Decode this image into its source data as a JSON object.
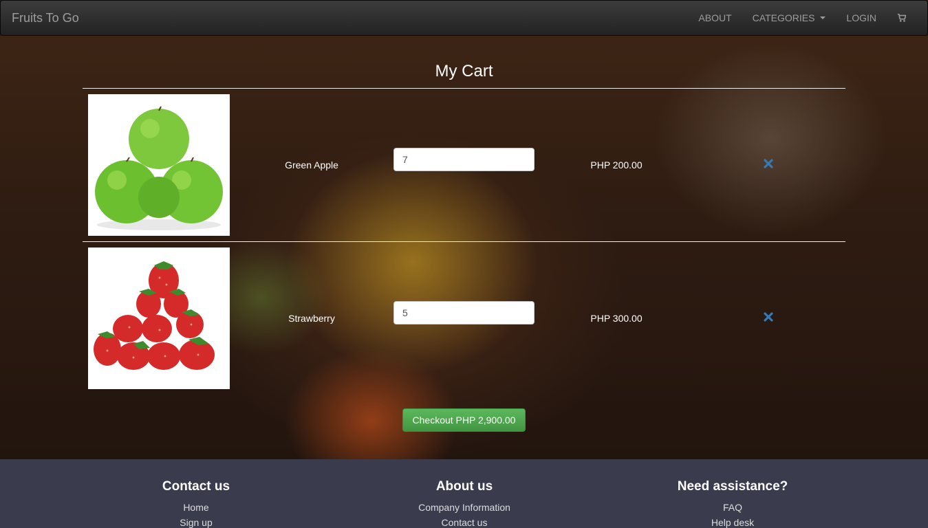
{
  "navbar": {
    "brand": "Fruits To Go",
    "links": [
      "ABOUT",
      "CATEGORIES",
      "LOGIN"
    ],
    "cart_icon": "shopping-cart-icon"
  },
  "cart": {
    "title": "My Cart",
    "items": [
      {
        "name": "Green Apple",
        "quantity": "7",
        "price": "PHP 200.00",
        "image": "green-apple-image"
      },
      {
        "name": "Strawberry",
        "quantity": "5",
        "price": "PHP 300.00",
        "image": "strawberry-image"
      }
    ],
    "remove_icon": "remove-x-icon",
    "checkout_label": "Checkout PHP 2,900.00"
  },
  "footer": {
    "columns": [
      {
        "title": "Contact us",
        "links": [
          "Home",
          "Sign up"
        ]
      },
      {
        "title": "About us",
        "links": [
          "Company Information",
          "Contact us"
        ]
      },
      {
        "title": "Need assistance?",
        "links": [
          "FAQ",
          "Help desk"
        ]
      }
    ]
  },
  "colors": {
    "navbar": "#222222",
    "checkout_green": "#5cb85c",
    "remove_blue": "#337ab7",
    "footer_bg": "#3a3c4e"
  }
}
